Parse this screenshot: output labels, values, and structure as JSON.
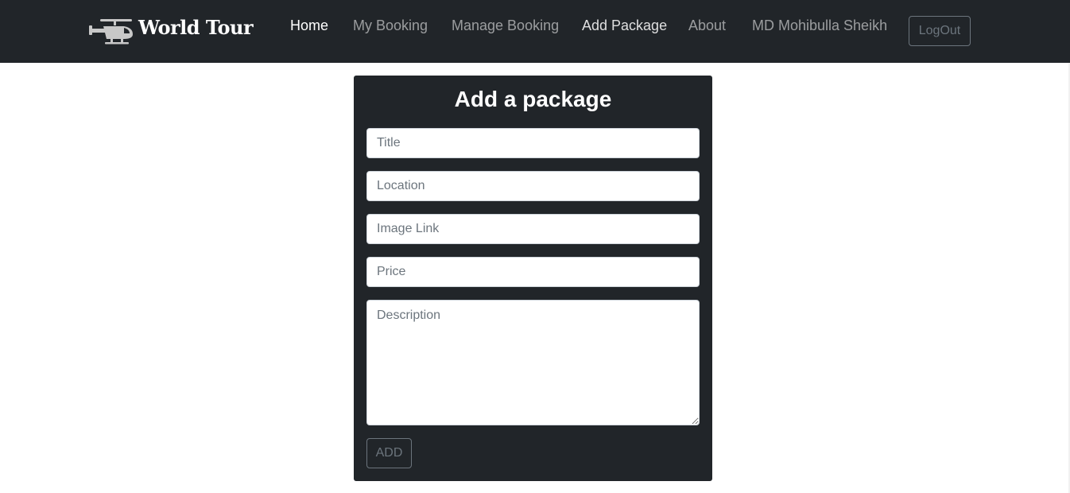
{
  "navbar": {
    "brand": {
      "name": "World Tour",
      "logo_icon": "helicopter-icon"
    },
    "links": {
      "home": "Home",
      "my_booking": "My Booking",
      "manage_booking": "Manage Booking",
      "add_package": "Add Package",
      "about": "About",
      "user_name": "MD Mohibulla Sheikh"
    },
    "logout_label": "LogOut",
    "background": "#212529"
  },
  "form": {
    "title": "Add a package",
    "fields": {
      "title": {
        "placeholder": "Title",
        "value": ""
      },
      "location": {
        "placeholder": "Location",
        "value": ""
      },
      "image_link": {
        "placeholder": "Image Link",
        "value": ""
      },
      "price": {
        "placeholder": "Price",
        "value": ""
      },
      "description": {
        "placeholder": "Description",
        "value": ""
      }
    },
    "submit_label": "ADD",
    "background": "#212529"
  }
}
